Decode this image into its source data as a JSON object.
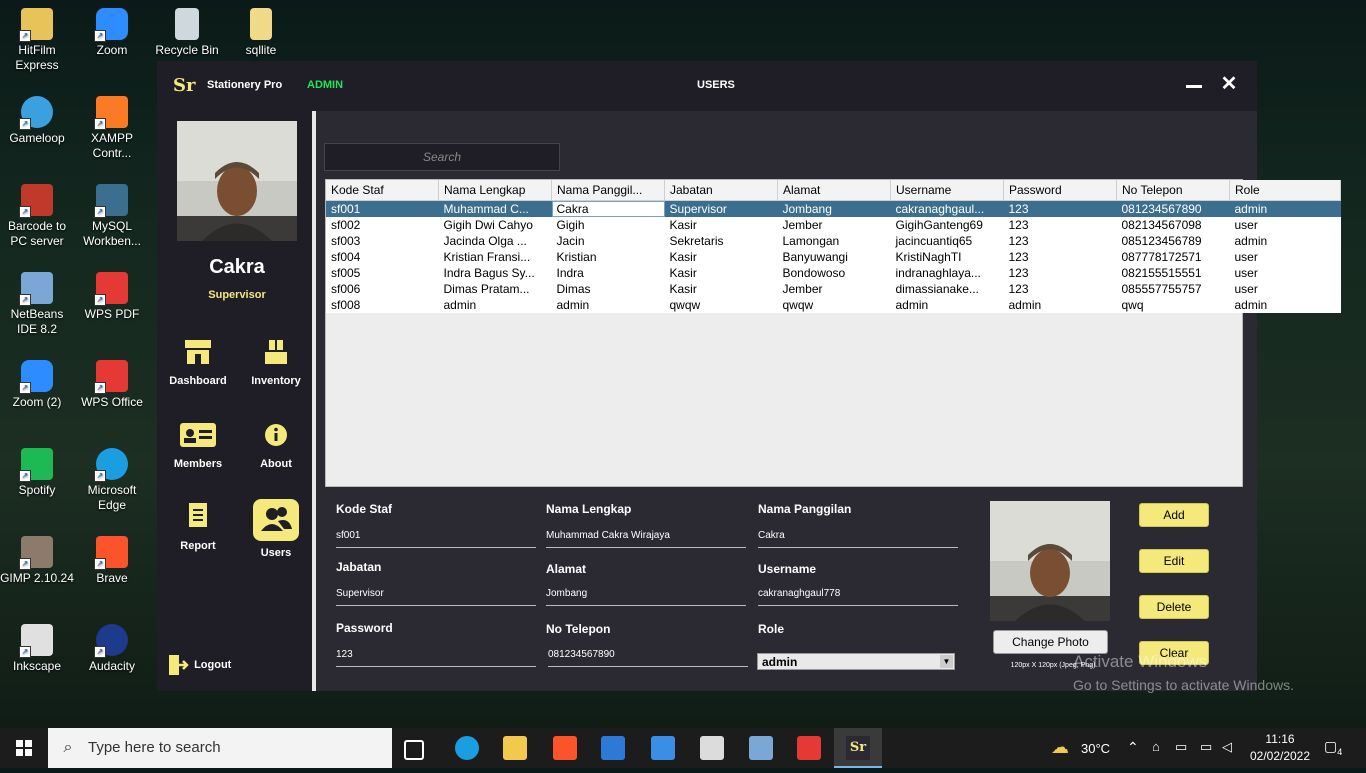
{
  "desktop": {
    "icons": [
      {
        "label": "HitFilm Express",
        "color": "#e8c35a"
      },
      {
        "label": "Zoom",
        "color": "#2d8cff"
      },
      {
        "label": "Recycle Bin",
        "color": "#cfd8dc"
      },
      {
        "label": "sqllite",
        "color": "#f1d98a"
      },
      {
        "label": "Gameloop",
        "color": "#3aa0e0"
      },
      {
        "label": "XAMPP Contr...",
        "color": "#fb7a24"
      },
      {
        "label": "Barcode to PC server",
        "color": "#c0392b"
      },
      {
        "label": "MySQL Workben...",
        "color": "#3b6e8f"
      },
      {
        "label": "NetBeans IDE 8.2",
        "color": "#7aa7d6"
      },
      {
        "label": "WPS PDF",
        "color": "#e53935"
      },
      {
        "label": "Zoom (2)",
        "color": "#2d8cff"
      },
      {
        "label": "WPS Office",
        "color": "#e53935"
      },
      {
        "label": "Spotify",
        "color": "#1db954"
      },
      {
        "label": "Microsoft Edge",
        "color": "#1b9de2"
      },
      {
        "label": "GIMP 2.10.24",
        "color": "#8c7b6a"
      },
      {
        "label": "Brave",
        "color": "#fb542b"
      },
      {
        "label": "Inkscape",
        "color": "#e0e0e0"
      },
      {
        "label": "Audacity",
        "color": "#1e3a8a"
      }
    ]
  },
  "app": {
    "logo": "Sr",
    "name": "Stationery Pro",
    "user_role_badge": "ADMIN",
    "page_title": "USERS"
  },
  "sidebar": {
    "user_name": "Cakra",
    "user_role": "Supervisor",
    "nav": [
      {
        "label": "Dashboard",
        "icon": "store-icon"
      },
      {
        "label": "Inventory",
        "icon": "boxes-icon"
      },
      {
        "label": "Members",
        "icon": "id-card-icon"
      },
      {
        "label": "About",
        "icon": "info-icon"
      },
      {
        "label": "Report",
        "icon": "document-icon"
      },
      {
        "label": "Users",
        "icon": "users-icon",
        "active": true
      }
    ],
    "logout": "Logout"
  },
  "search": {
    "placeholder": "Search"
  },
  "table": {
    "columns": [
      "Kode Staf",
      "Nama Lengkap",
      "Nama Panggil...",
      "Jabatan",
      "Alamat",
      "Username",
      "Password",
      "No Telepon",
      "Role"
    ],
    "rows": [
      [
        "sf001",
        "Muhammad C...",
        "Cakra",
        "Supervisor",
        "Jombang",
        "cakranaghgaul...",
        "123",
        "081234567890",
        "admin"
      ],
      [
        "sf002",
        "Gigih Dwi Cahyo",
        "Gigih",
        "Kasir",
        "Jember",
        "GigihGanteng69",
        "123",
        "082134567098",
        "user"
      ],
      [
        "sf003",
        "Jacinda Olga ...",
        "Jacin",
        "Sekretaris",
        "Lamongan",
        "jacincuantiq65",
        "123",
        "085123456789",
        "admin"
      ],
      [
        "sf004",
        "Kristian Fransi...",
        "Kristian",
        "Kasir",
        "Banyuwangi",
        "KristiNaghTI",
        "123",
        "087778172571",
        "user"
      ],
      [
        "sf005",
        "Indra Bagus Sy...",
        "Indra",
        "Kasir",
        "Bondowoso",
        "indranaghlaya...",
        "123",
        "082155515551",
        "user"
      ],
      [
        "sf006",
        "Dimas Pratam...",
        "Dimas",
        "Kasir",
        "Jember",
        "dimassianake...",
        "123",
        "085557755757",
        "user"
      ],
      [
        "sf008",
        "admin",
        "admin",
        "qwqw",
        "qwqw",
        "admin",
        "admin",
        "qwq",
        "admin"
      ]
    ],
    "selected_row": 0
  },
  "form": {
    "kode_staf_label": "Kode Staf",
    "kode_staf": "sf001",
    "nama_lengkap_label": "Nama Lengkap",
    "nama_lengkap": "Muhammad Cakra Wirajaya",
    "nama_panggilan_label": "Nama Panggilan",
    "nama_panggilan": "Cakra",
    "jabatan_label": "Jabatan",
    "jabatan": "Supervisor",
    "alamat_label": "Alamat",
    "alamat": "Jombang",
    "username_label": "Username",
    "username": "cakranaghgaul778",
    "password_label": "Password",
    "password": "123",
    "no_telepon_label": "No Telepon",
    "no_telepon": "081234567890",
    "role_label": "Role",
    "role": "admin",
    "change_photo": "Change Photo",
    "photo_note": "120px X 120px (Jpeg, Png)"
  },
  "actions": {
    "add": "Add",
    "edit": "Edit",
    "delete": "Delete",
    "clear": "Clear"
  },
  "watermark": {
    "line1": "Activate Windows",
    "line2": "Go to Settings to activate Windows."
  },
  "taskbar": {
    "search_placeholder": "Type here to search",
    "temperature": "30°C",
    "time": "11:16",
    "date": "02/02/2022",
    "notifications": "4"
  },
  "colors": {
    "accent": "#f4e97a",
    "admin_badge": "#22e35a",
    "selection": "#3c6e8f",
    "panel": "#2b2a33",
    "sidebar": "#1f1e26"
  }
}
